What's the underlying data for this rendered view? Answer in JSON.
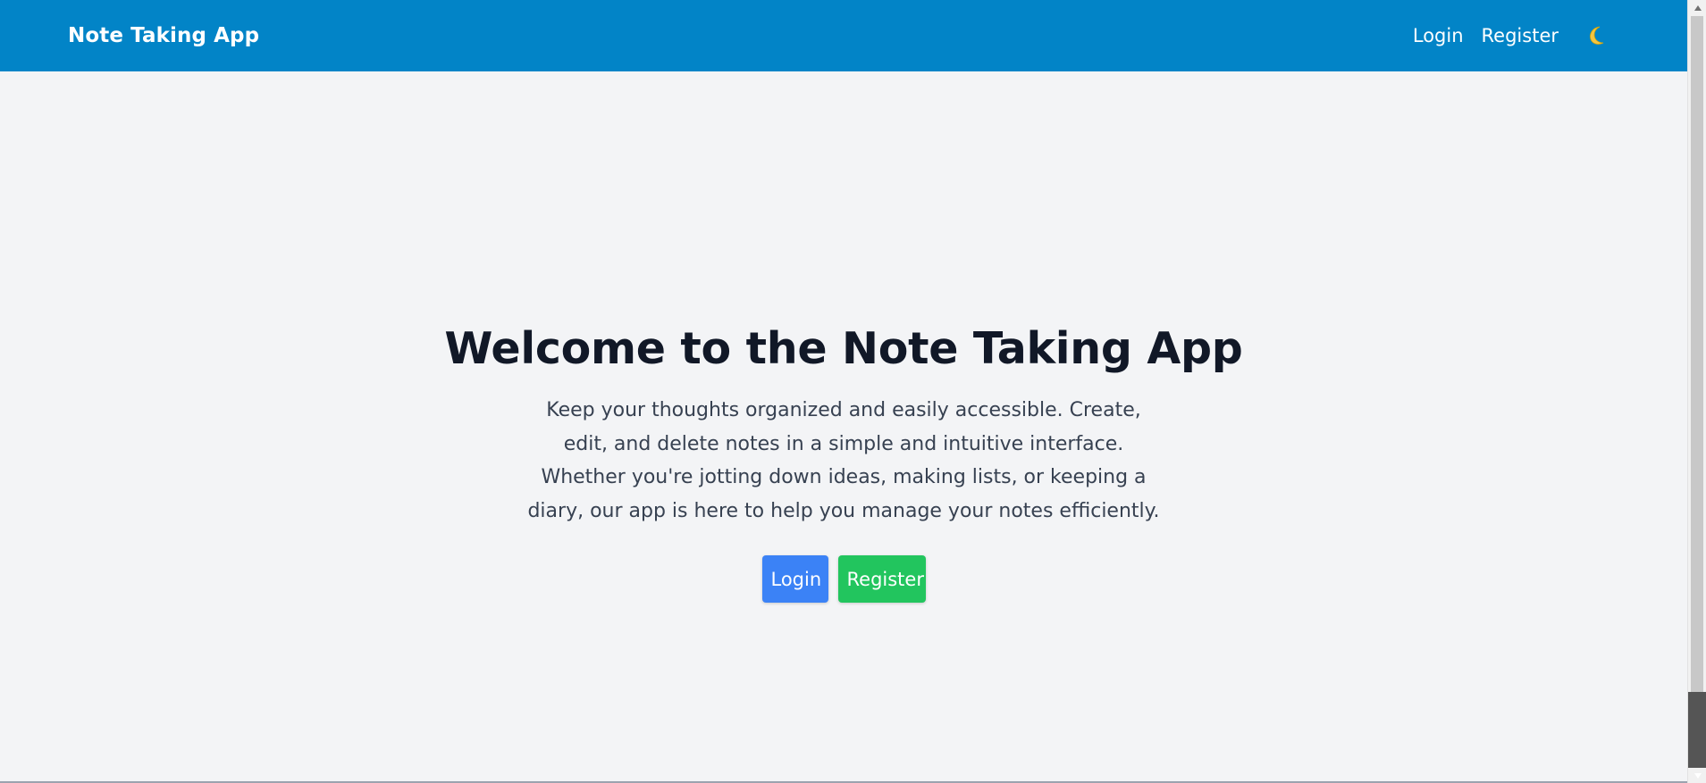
{
  "colors": {
    "navbar_bg": "#0284c7",
    "page_bg": "#f3f4f6",
    "login_button_bg": "#3b82f6",
    "register_button_bg": "#22c55e",
    "moon_icon": "#f5c542"
  },
  "navbar": {
    "brand": "Note Taking App",
    "links": {
      "login": "Login",
      "register": "Register"
    },
    "theme_icon": "moon-icon"
  },
  "hero": {
    "title": "Welcome to the Note Taking App",
    "description": "Keep your thoughts organized and easily accessible. Create, edit, and delete notes in a simple and intuitive interface. Whether you're jotting down ideas, making lists, or keeping a diary, our app is here to help you manage your notes efficiently.",
    "buttons": {
      "login": "Login",
      "register": "Register"
    }
  }
}
